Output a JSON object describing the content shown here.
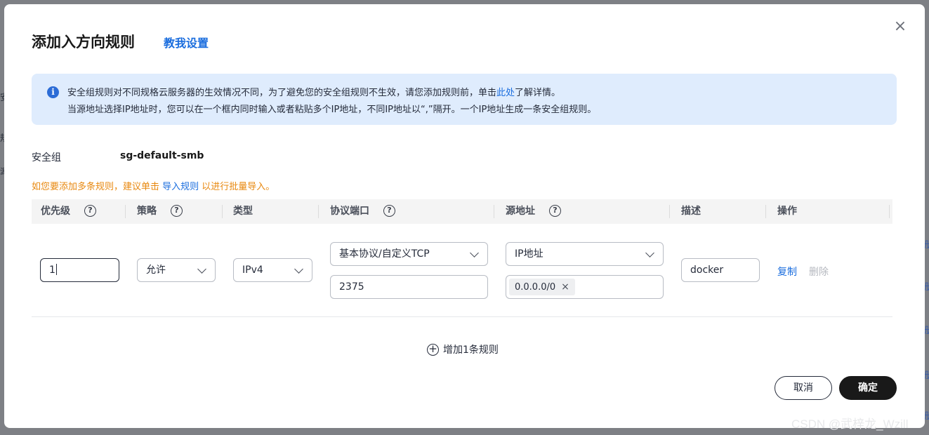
{
  "dialog": {
    "title": "添加入方向规则",
    "guide_link": "教我设置",
    "close_symbol": "×"
  },
  "info": {
    "icon_glyph": "i",
    "line1_prefix": "安全组规则对不同规格云服务器的生效情况不同，为了避免您的安全组规则不生效，请您添加规则前，单击",
    "line1_link": "此处",
    "line1_suffix": "了解详情。",
    "line2": "当源地址选择IP地址时，您可以在一个框内同时输入或者粘贴多个IP地址，不同IP地址以“,”隔开。一个IP地址生成一条安全组规则。"
  },
  "security_group": {
    "label": "安全组",
    "value": "sg-default-smb"
  },
  "hint": {
    "prefix": "如您要添加多条规则，建议单击 ",
    "link": "导入规则",
    "suffix": " 以进行批量导入。"
  },
  "table": {
    "help_glyph": "?",
    "columns": {
      "priority": "优先级",
      "policy": "策略",
      "type": "类型",
      "protocol_port": "协议端口",
      "source": "源地址",
      "description": "描述",
      "actions": "操作"
    },
    "row": {
      "priority": "1",
      "policy": "允许",
      "type": "IPv4",
      "protocol": "基本协议/自定义TCP",
      "port": "2375",
      "source_type": "IP地址",
      "source_tag": "0.0.0.0/0",
      "tag_remove": "×",
      "description": "docker",
      "copy": "复制",
      "delete": "删除"
    },
    "add_rule": "增加1条规则",
    "add_glyph": "+"
  },
  "footer": {
    "cancel": "取消",
    "ok": "确定"
  },
  "background": {
    "left_glyph_1": "安",
    "left_glyph_2": "规",
    "left_glyph_3": "源",
    "right_link": "册"
  },
  "watermark": "CSDN @武梓龙_Wzill",
  "colors": {
    "accent": "#1a6dde",
    "hint": "#e8880f",
    "info_bg": "#dfecfd",
    "primary_button": "#191919"
  }
}
